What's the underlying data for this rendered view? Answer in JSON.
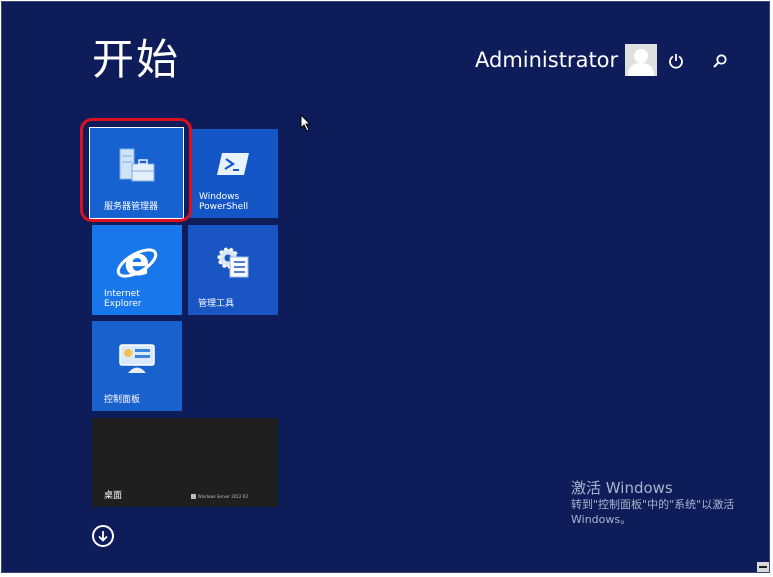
{
  "header": {
    "title": "开始",
    "user_name": "Administrator",
    "icons": {
      "avatar": "user-avatar-icon",
      "power": "power-icon",
      "search": "search-icon"
    }
  },
  "tiles": [
    {
      "id": "server-manager",
      "label": "服务器管理器",
      "icon": "server-manager-icon",
      "color": "#1761d1",
      "selected": true
    },
    {
      "id": "powershell",
      "label": "Windows\nPowerShell",
      "icon": "powershell-icon",
      "color": "#1556c7"
    },
    {
      "id": "internet-explorer",
      "label": "Internet\nExplorer",
      "icon": "internet-explorer-icon",
      "color": "#1877ea"
    },
    {
      "id": "admin-tools",
      "label": "管理工具",
      "icon": "admin-tools-icon",
      "color": "#1a55c4"
    },
    {
      "id": "control-panel",
      "label": "控制面板",
      "icon": "control-panel-icon",
      "color": "#1961cc"
    },
    {
      "id": "desktop",
      "label": "桌面",
      "icon": "desktop-icon",
      "color": "#1f1f1f",
      "watermark": "Windows Server 2012 R2"
    }
  ],
  "footer": {
    "all_apps_icon": "arrow-down-circle-icon",
    "activation_title": "激活 Windows",
    "activation_desc": "转到\"控制面板\"中的\"系统\"以激活 Windows。"
  },
  "colors": {
    "background": "#0e1d5a",
    "highlight": "#dd1020",
    "text": "#ffffff"
  }
}
